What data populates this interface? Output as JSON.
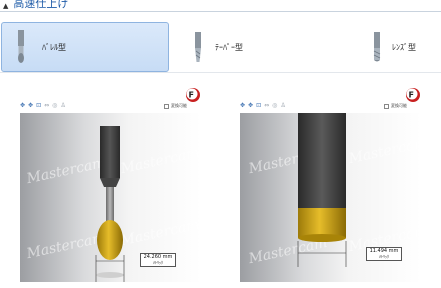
{
  "section": {
    "title": "高速仕上げ"
  },
  "tool_types": [
    {
      "label": "ﾊﾞﾚﾙ型",
      "icon": "barrel-endmill-icon",
      "selected": true
    },
    {
      "label": "ﾃｰﾊﾟｰ型",
      "icon": "taper-endmill-icon",
      "selected": false
    },
    {
      "label": "ﾚﾝｽﾞ型",
      "icon": "lens-endmill-icon",
      "selected": false
    }
  ],
  "previews": [
    {
      "checkbox_label": "変換可能",
      "watermark": "Mastercam",
      "dimension": {
        "value": "24.260 mm",
        "unit": "ﾒﾄﾘｯｸ"
      }
    },
    {
      "checkbox_label": "変換可能",
      "watermark": "Mastercam",
      "dimension": {
        "value": "11.494 mm",
        "unit": "ﾒﾄﾘｯｸ"
      }
    }
  ],
  "colors": {
    "accent": "#1e5ba8",
    "selected_bg": "#c7dcf5",
    "tool_gold": "#d4a316",
    "tool_dark": "#3a3a3a"
  }
}
